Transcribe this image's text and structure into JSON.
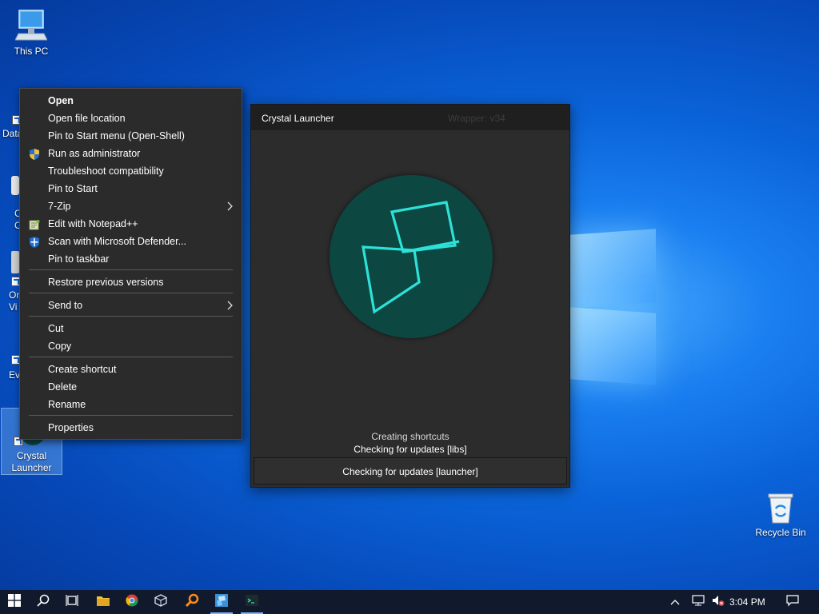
{
  "desktop": {
    "this_pc_label": "This PC",
    "peek_labels": [
      "Data",
      "C",
      "C",
      "On",
      "Vi",
      "Ev"
    ],
    "crystal_label_1": "Crystal",
    "crystal_label_2": "Launcher",
    "recycle_label": "Recycle Bin"
  },
  "context_menu": {
    "items": [
      {
        "label": "Open"
      },
      {
        "label": "Open file location"
      },
      {
        "label": "Pin to Start menu (Open-Shell)"
      },
      {
        "label": "Run as administrator"
      },
      {
        "label": "Troubleshoot compatibility"
      },
      {
        "label": "Pin to Start"
      },
      {
        "label": "7-Zip"
      },
      {
        "label": "Edit with Notepad++"
      },
      {
        "label": "Scan with Microsoft Defender..."
      },
      {
        "label": "Pin to taskbar"
      },
      {
        "label": "Restore previous versions"
      },
      {
        "label": "Send to"
      },
      {
        "label": "Cut"
      },
      {
        "label": "Copy"
      },
      {
        "label": "Create shortcut"
      },
      {
        "label": "Delete"
      },
      {
        "label": "Rename"
      },
      {
        "label": "Properties"
      }
    ],
    "submenu_arrow": ">"
  },
  "launcher": {
    "title": "Crystal Launcher",
    "version": "Wrapper: v34",
    "status_line_1": "Creating shortcuts",
    "status_line_2": "Checking for updates [libs]",
    "progress_text": "Checking for updates [launcher]",
    "accent_color": "#2ce2d8",
    "circle_color": "#0d4742"
  },
  "taskbar": {
    "time": "3:04 PM",
    "icons": [
      "windows-start-icon",
      "search-icon",
      "task-view-icon",
      "file-explorer-icon",
      "chrome-icon",
      "virtualbox-icon",
      "search-app-icon",
      "crystal-launcher-icon",
      "terminal-icon"
    ],
    "tray": [
      "chevron-up-icon",
      "network-icon",
      "volume-muted-icon",
      "notifications-icon"
    ]
  }
}
